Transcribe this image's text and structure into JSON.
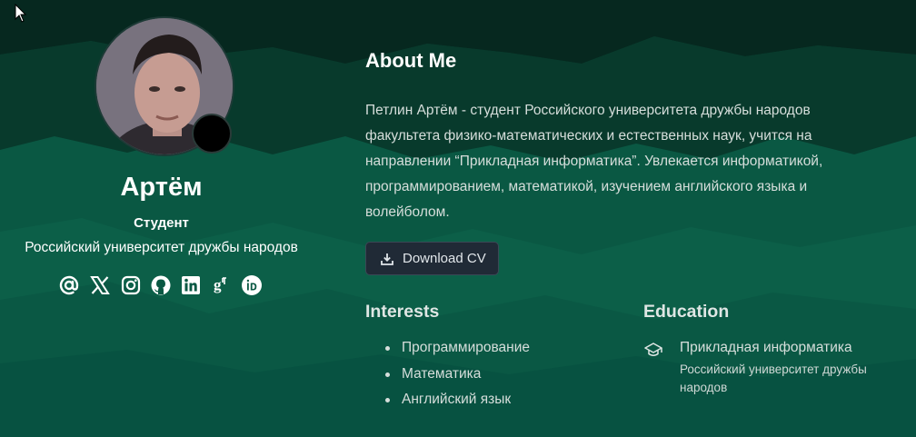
{
  "profile": {
    "name": "Артём",
    "role": "Студент",
    "organization": "Российский университет дружбы народов",
    "socials": [
      {
        "icon": "at-sign-icon"
      },
      {
        "icon": "x-twitter-icon"
      },
      {
        "icon": "instagram-icon"
      },
      {
        "icon": "github-icon"
      },
      {
        "icon": "linkedin-icon"
      },
      {
        "icon": "google-scholar-icon"
      },
      {
        "icon": "orcid-icon"
      }
    ]
  },
  "about": {
    "title": "About Me",
    "text": "Петлин Артём - студент Российского университета дружбы народов факультета физико-математических и естественных наук, учится на направлении “Прикладная информатика”. Увлекается информатикой, программированием, математикой, изучением английского языка и волейболом.",
    "download_label": "Download CV"
  },
  "interests": {
    "title": "Interests",
    "items": [
      "Программирование",
      "Математика",
      "Английский язык"
    ]
  },
  "education": {
    "title": "Education",
    "degree": "Прикладная информатика",
    "institution": "Российский университет дружбы народов"
  },
  "colors": {
    "background": "#064b3a",
    "button_background": "#202a36",
    "text_primary": "#ffffff",
    "text_secondary": "#d6dedb"
  }
}
